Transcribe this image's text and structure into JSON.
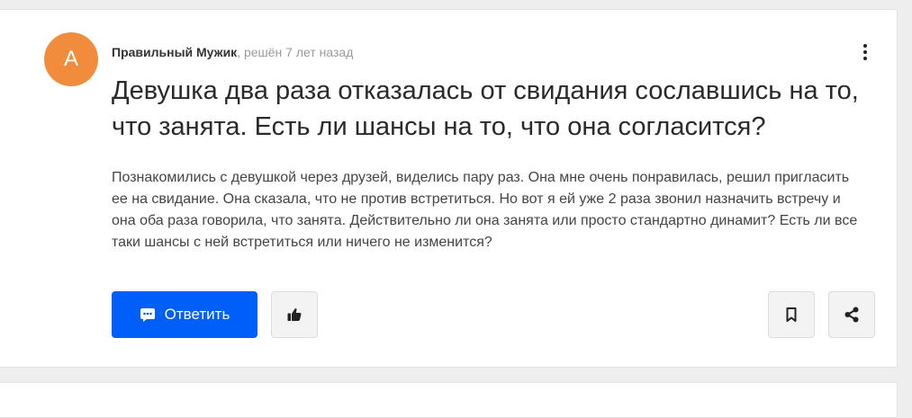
{
  "question": {
    "avatar_letter": "А",
    "author": "Правильный Мужик",
    "meta_suffix": ", решён 7 лет назад",
    "title": "Девушка два раза отказалась от свидания сославшись на то, что занята. Есть ли шансы на то, что она согласится?",
    "body": "Познакомились с девушкой через друзей, виделись пару раз. Она мне очень понравилась, решил пригласить ее на свидание. Она сказала, что не против встретиться. Но вот я ей уже 2 раза звонил назначить встречу и она оба раза говорила, что занята. Действительно ли она занята или просто стандартно динамит? Есть ли все таки шансы с ней встретиться или ничего не изменится?"
  },
  "actions": {
    "answer_label": "Ответить",
    "like_icon": "thumbs-up-icon",
    "bookmark_icon": "bookmark-icon",
    "share_icon": "share-icon",
    "more_icon": "more-vertical-icon"
  },
  "colors": {
    "accent": "#005ff9",
    "avatar_bg": "#f28c3d"
  }
}
